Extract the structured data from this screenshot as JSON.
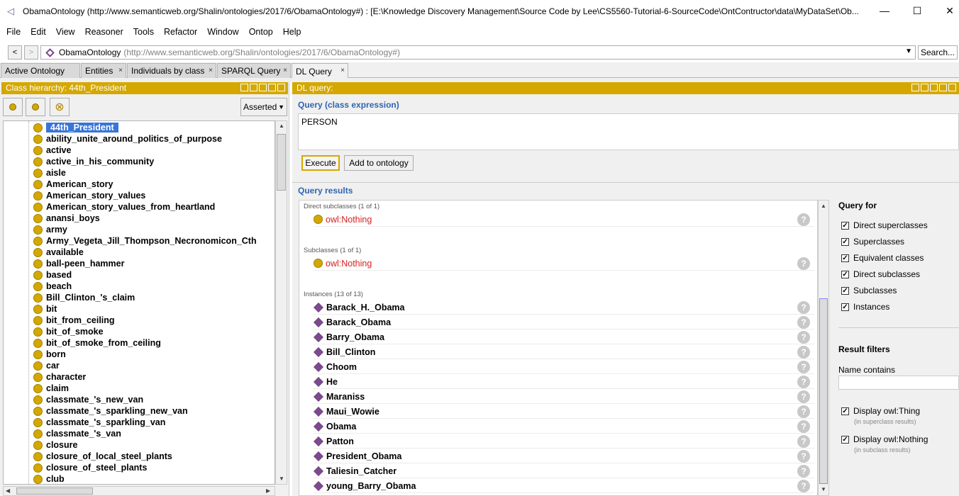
{
  "window": {
    "title": "ObamaOntology (http://www.semanticweb.org/Shalin/ontologies/2017/6/ObamaOntology#)  : [E:\\Knowledge Discovery Management\\Source Code by Lee\\CS5560-Tutorial-6-SourceCode\\OntContructor\\data\\MyDataSet\\Ob...",
    "minimize": "—",
    "maximize": "☐",
    "close": "✕"
  },
  "menu": [
    "File",
    "Edit",
    "View",
    "Reasoner",
    "Tools",
    "Refactor",
    "Window",
    "Ontop",
    "Help"
  ],
  "address": {
    "back": "<",
    "forward": ">",
    "ontology_name": "ObamaOntology",
    "ontology_iri": "(http://www.semanticweb.org/Shalin/ontologies/2017/6/ObamaOntology#)",
    "search_label": "Search..."
  },
  "tabs": [
    "Active Ontology",
    "Entities",
    "Individuals by class",
    "SPARQL Query",
    "DL Query"
  ],
  "left_panel": {
    "header": "Class hierarchy: 44th_President",
    "mode": "Asserted",
    "classes": [
      "44th_President",
      "ability_unite_around_politics_of_purpose",
      "active",
      "active_in_his_community",
      "aisle",
      "American_story",
      "American_story_values",
      "American_story_values_from_heartland",
      "anansi_boys",
      "army",
      "Army_Vegeta_Jill_Thompson_Necronomicon_Cth",
      "available",
      "ball-peen_hammer",
      "based",
      "beach",
      "Bill_Clinton_'s_claim",
      "bit",
      "bit_from_ceiling",
      "bit_of_smoke",
      "bit_of_smoke_from_ceiling",
      "born",
      "car",
      "character",
      "claim",
      "classmate_'s_new_van",
      "classmate_'s_sparkling_new_van",
      "classmate_'s_sparkling_van",
      "classmate_'s_van",
      "closure",
      "closure_of_local_steel_plants",
      "closure_of_steel_plants",
      "club"
    ]
  },
  "right_panel": {
    "header": "DL query:",
    "query_label": "Query (class expression)",
    "query_text": "PERSON",
    "execute_label": "Execute",
    "add_label": "Add to ontology",
    "results_label": "Query results",
    "direct_subclasses_label": "Direct subclasses (1 of 1)",
    "direct_subclasses": [
      "owl:Nothing"
    ],
    "subclasses_label": "Subclasses (1 of 1)",
    "subclasses": [
      "owl:Nothing"
    ],
    "instances_label": "Instances (13 of 13)",
    "instances": [
      "Barack_H._Obama",
      "Barack_Obama",
      "Barry_Obama",
      "Bill_Clinton",
      "Choom",
      "He",
      "Maraniss",
      "Maui_Wowie",
      "Obama",
      "Patton",
      "President_Obama",
      "Taliesin_Catcher",
      "young_Barry_Obama"
    ],
    "help_glyph": "?",
    "query_for_label": "Query for",
    "query_for": [
      {
        "label": "Direct superclasses",
        "checked": true
      },
      {
        "label": "Superclasses",
        "checked": true
      },
      {
        "label": "Equivalent classes",
        "checked": true
      },
      {
        "label": "Direct subclasses",
        "checked": true
      },
      {
        "label": "Subclasses",
        "checked": true
      },
      {
        "label": "Instances",
        "checked": true
      }
    ],
    "result_filters_label": "Result filters",
    "name_contains_label": "Name contains",
    "display_thing_label": "Display owl:Thing",
    "display_thing_note": "(in superclass results)",
    "display_nothing_label": "Display owl:Nothing",
    "display_nothing_note": "(in subclass results)"
  },
  "colors": {
    "panel_header": "#d4a800",
    "selection": "#3875d7",
    "section_label": "#3065b0",
    "nothing_red": "#d82020",
    "individual": "#7b4a8a"
  }
}
